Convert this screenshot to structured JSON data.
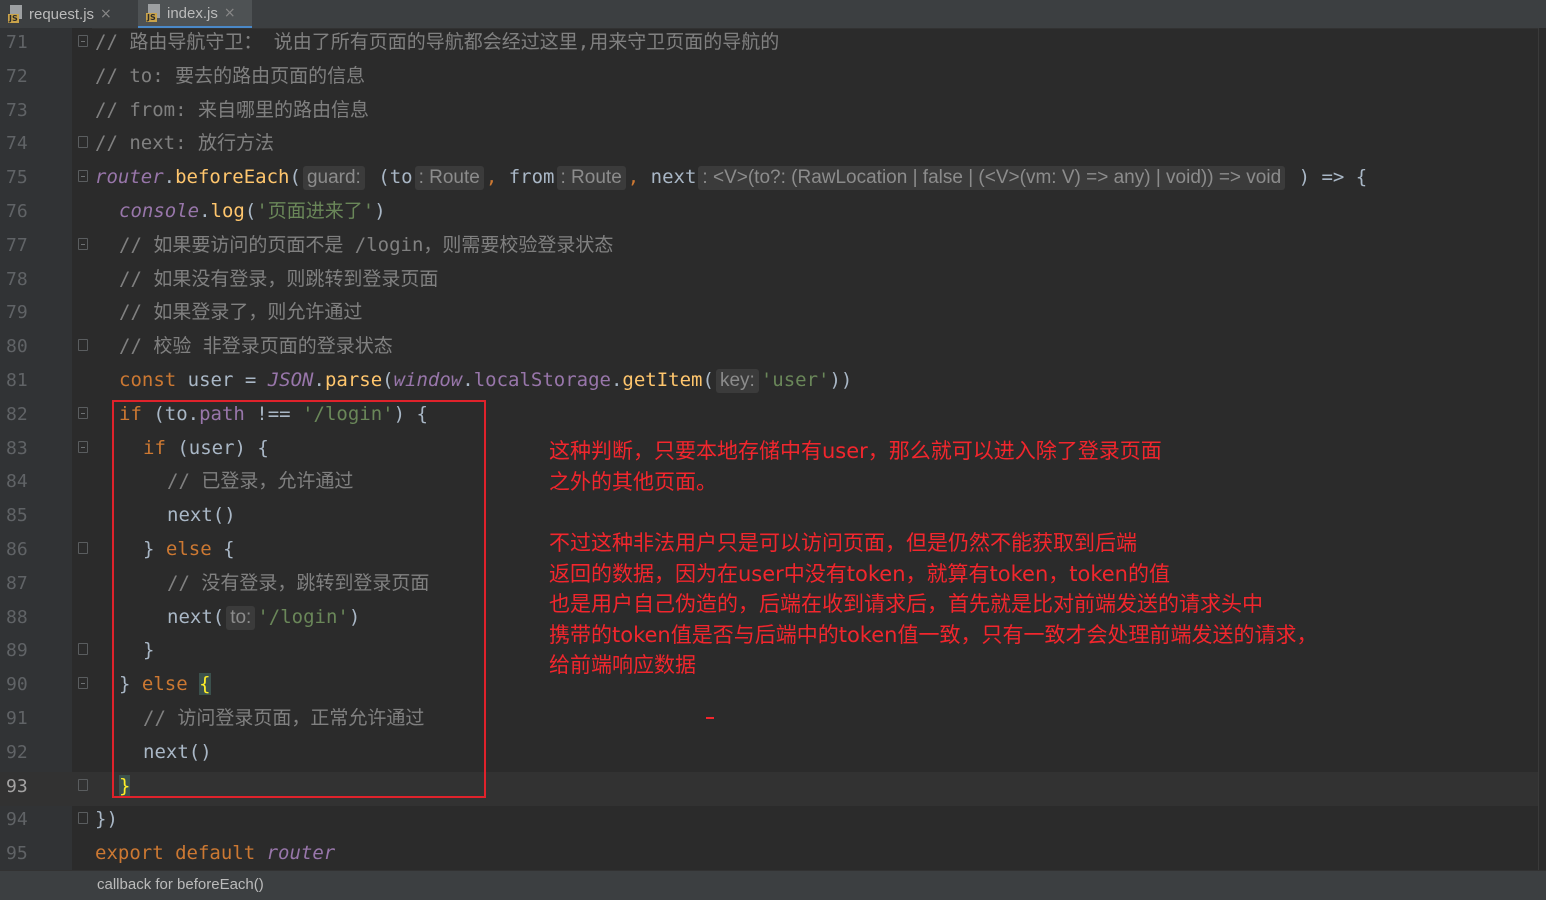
{
  "tabs": [
    {
      "label": "request.js",
      "icon": "js-file-icon",
      "badge": "JS",
      "close": "×"
    },
    {
      "label": "index.js",
      "icon": "js-file-icon",
      "badge": "JS",
      "close": "×",
      "active": true
    }
  ],
  "colors": {
    "background": "#2b2b2b",
    "comment": "#808080",
    "keyword": "#cc7832",
    "string": "#6a8759",
    "function": "#ffc66d",
    "global": "#9876aa",
    "annotation_red": "#f2262d"
  },
  "lines": [
    {
      "num": "71",
      "fold": "open",
      "segments": [
        {
          "t": "// 路由导航守卫： 说由了所有页面的导航都会经过这里,用来守卫页面的导航的",
          "c": "cm"
        }
      ]
    },
    {
      "num": "72",
      "segments": [
        {
          "t": "// to: 要去的路由页面的信息",
          "c": "cm"
        }
      ]
    },
    {
      "num": "73",
      "segments": [
        {
          "t": "// from: 来自哪里的路由信息",
          "c": "cm"
        }
      ]
    },
    {
      "num": "74",
      "fold": "close",
      "segments": [
        {
          "t": "// next: 放行方法",
          "c": "cm"
        }
      ]
    },
    {
      "num": "75",
      "fold": "open",
      "segments": [
        {
          "t": "router",
          "c": "gl"
        },
        {
          "t": ".",
          "c": "sym"
        },
        {
          "t": "beforeEach",
          "c": "fn"
        },
        {
          "t": "(",
          "c": "sym"
        },
        {
          "t": "guard:",
          "c": "hint"
        },
        {
          "t": " (to",
          "c": "sym"
        },
        {
          "t": ": Route",
          "c": "hint"
        },
        {
          "t": ", ",
          "c": "kw"
        },
        {
          "t": "from",
          "c": "sym"
        },
        {
          "t": ": Route",
          "c": "hint"
        },
        {
          "t": ", ",
          "c": "kw"
        },
        {
          "t": "next",
          "c": "sym"
        },
        {
          "t": ": <V>(to?: (RawLocation | false | (<V>(vm: V) => any) | void)) => void",
          "c": "hint"
        },
        {
          "t": " ) => {",
          "c": "sym"
        }
      ]
    },
    {
      "num": "76",
      "indent": 1,
      "segments": [
        {
          "t": "console",
          "c": "gl"
        },
        {
          "t": ".",
          "c": "sym"
        },
        {
          "t": "log",
          "c": "fn"
        },
        {
          "t": "(",
          "c": "sym"
        },
        {
          "t": "'页面进来了'",
          "c": "str"
        },
        {
          "t": ")",
          "c": "sym"
        }
      ]
    },
    {
      "num": "77",
      "indent": 1,
      "fold": "open",
      "segments": [
        {
          "t": "// 如果要访问的页面不是 /login，则需要校验登录状态",
          "c": "cm"
        }
      ]
    },
    {
      "num": "78",
      "indent": 1,
      "segments": [
        {
          "t": "// 如果没有登录，则跳转到登录页面",
          "c": "cm"
        }
      ]
    },
    {
      "num": "79",
      "indent": 1,
      "segments": [
        {
          "t": "// 如果登录了，则允许通过",
          "c": "cm"
        }
      ]
    },
    {
      "num": "80",
      "indent": 1,
      "fold": "close",
      "segments": [
        {
          "t": "// 校验 非登录页面的登录状态",
          "c": "cm"
        }
      ]
    },
    {
      "num": "81",
      "indent": 1,
      "segments": [
        {
          "t": "const ",
          "c": "kw"
        },
        {
          "t": "user = ",
          "c": "sym"
        },
        {
          "t": "JSON",
          "c": "gl"
        },
        {
          "t": ".",
          "c": "sym"
        },
        {
          "t": "parse",
          "c": "fn"
        },
        {
          "t": "(",
          "c": "sym"
        },
        {
          "t": "window",
          "c": "gl"
        },
        {
          "t": ".",
          "c": "sym"
        },
        {
          "t": "localStorage",
          "c": "prop"
        },
        {
          "t": ".",
          "c": "sym"
        },
        {
          "t": "getItem",
          "c": "fn"
        },
        {
          "t": "(",
          "c": "sym"
        },
        {
          "t": "key:",
          "c": "hint"
        },
        {
          "t": "'user'",
          "c": "str"
        },
        {
          "t": "))",
          "c": "sym"
        }
      ]
    },
    {
      "num": "82",
      "indent": 1,
      "fold": "open",
      "segments": [
        {
          "t": "if ",
          "c": "kw"
        },
        {
          "t": "(to.",
          "c": "sym"
        },
        {
          "t": "path",
          "c": "prop"
        },
        {
          "t": " !== ",
          "c": "sym"
        },
        {
          "t": "'/login'",
          "c": "str"
        },
        {
          "t": ") {",
          "c": "sym"
        }
      ]
    },
    {
      "num": "83",
      "indent": 2,
      "fold": "open",
      "segments": [
        {
          "t": "if ",
          "c": "kw"
        },
        {
          "t": "(user) {",
          "c": "sym"
        }
      ]
    },
    {
      "num": "84",
      "indent": 3,
      "segments": [
        {
          "t": "// 已登录，允许通过",
          "c": "cm"
        }
      ]
    },
    {
      "num": "85",
      "indent": 3,
      "segments": [
        {
          "t": "next()",
          "c": "sym"
        }
      ]
    },
    {
      "num": "86",
      "indent": 2,
      "fold": "close",
      "segments": [
        {
          "t": "} ",
          "c": "sym"
        },
        {
          "t": "else ",
          "c": "kw"
        },
        {
          "t": "{",
          "c": "sym"
        }
      ]
    },
    {
      "num": "87",
      "indent": 3,
      "segments": [
        {
          "t": "// 没有登录，跳转到登录页面",
          "c": "cm"
        }
      ]
    },
    {
      "num": "88",
      "indent": 3,
      "segments": [
        {
          "t": "next(",
          "c": "sym"
        },
        {
          "t": "to:",
          "c": "hint"
        },
        {
          "t": "'/login'",
          "c": "str"
        },
        {
          "t": ")",
          "c": "sym"
        }
      ]
    },
    {
      "num": "89",
      "indent": 2,
      "fold": "close",
      "segments": [
        {
          "t": "}",
          "c": "sym"
        }
      ]
    },
    {
      "num": "90",
      "indent": 1,
      "fold": "open",
      "segments": [
        {
          "t": "} ",
          "c": "sym"
        },
        {
          "t": "else ",
          "c": "kw"
        },
        {
          "t": "{",
          "c": "brace-hl"
        }
      ]
    },
    {
      "num": "91",
      "indent": 2,
      "segments": [
        {
          "t": "// 访问登录页面，正常允许通过",
          "c": "cm"
        }
      ]
    },
    {
      "num": "92",
      "indent": 2,
      "segments": [
        {
          "t": "next()",
          "c": "sym"
        }
      ]
    },
    {
      "num": "93",
      "indent": 1,
      "fold": "close",
      "current": true,
      "segments": [
        {
          "t": "}",
          "c": "brace-hl"
        }
      ]
    },
    {
      "num": "94",
      "fold": "close",
      "segments": [
        {
          "t": "})",
          "c": "sym"
        }
      ]
    },
    {
      "num": "95",
      "segments": [
        {
          "t": "export default ",
          "c": "kw"
        },
        {
          "t": "router",
          "c": "gl"
        }
      ]
    }
  ],
  "annotation": {
    "paragraph1": "这种判断，只要本地存储中有user，那么就可以进入除了登录页面\n之外的其他页面。",
    "paragraph2": "不过这种非法用户只是可以访问页面，但是仍然不能获取到后端\n返回的数据，因为在user中没有token，就算有token，token的值\n也是用户自己伪造的，后端在收到请求后，首先就是比对前端发送的请求头中\n携带的token值是否与后端中的token值一致，只有一致才会处理前端发送的请求，\n给前端响应数据"
  },
  "status": {
    "text": "callback for beforeEach()"
  }
}
